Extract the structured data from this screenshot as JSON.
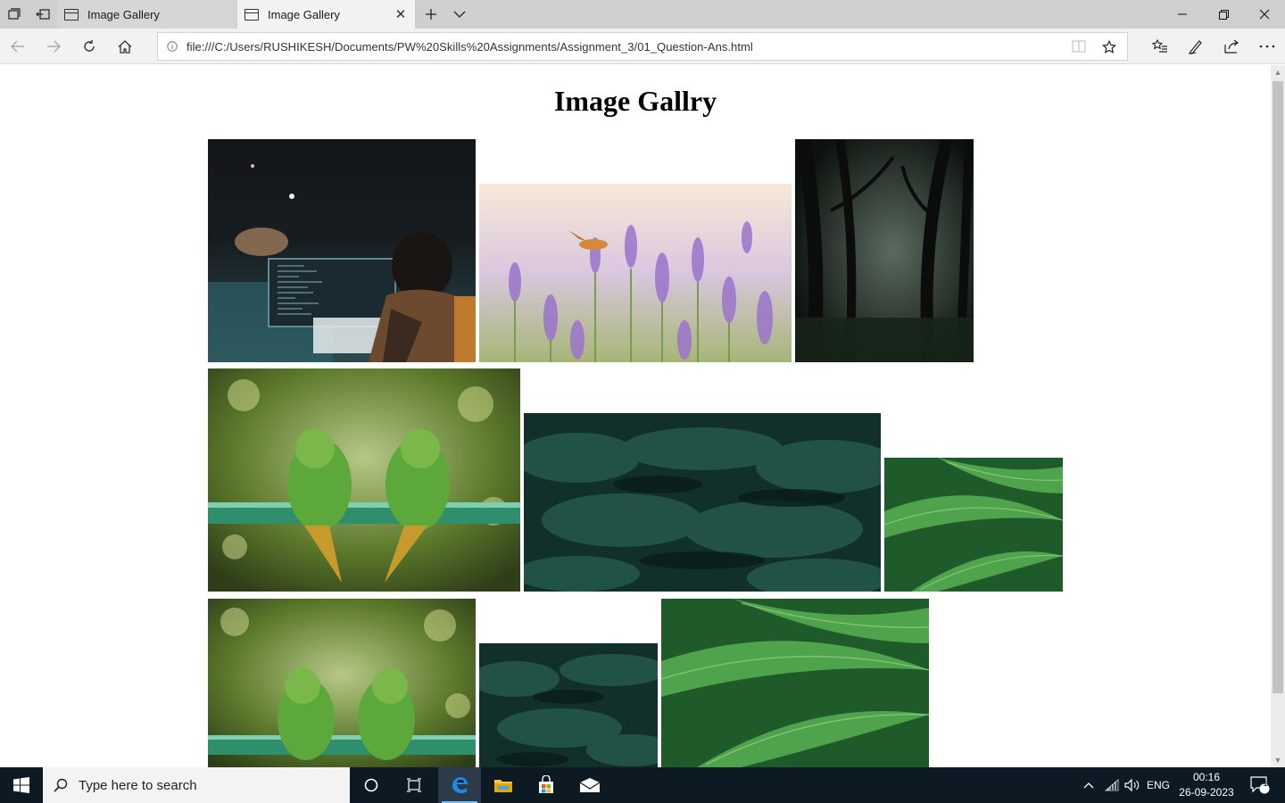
{
  "browser": {
    "tabs": [
      {
        "title": "Image Gallery",
        "active": false
      },
      {
        "title": "Image Gallery",
        "active": true
      }
    ],
    "address_url": "file:///C:/Users/RUSHIKESH/Documents/PW%20Skills%20Assignments/Assignment_3/01_Question-Ans.html",
    "tab_close_glyph": "✕"
  },
  "page": {
    "title": "Image Gallry"
  },
  "gallery": {
    "images": [
      {
        "name": "developer-at-desk-photo",
        "subject": "developer coding at desk",
        "palette": [
          "#141c20",
          "#1d3a40",
          "#3b6f74",
          "#8a5a34"
        ]
      },
      {
        "name": "lavender-moth-photo",
        "subject": "moth over lavender field",
        "palette": [
          "#f4e8d8",
          "#cdb8dc",
          "#9a78c8",
          "#9ab070"
        ]
      },
      {
        "name": "dark-forest-photo",
        "subject": "dark misty forest",
        "palette": [
          "#0e130f",
          "#2c3a2e",
          "#57665a",
          "#151c16"
        ]
      },
      {
        "name": "parrots-photo-1",
        "subject": "two green parrots on rail",
        "palette": [
          "#5b7b2c",
          "#9ab94a",
          "#2f8f5f",
          "#3a4a22"
        ]
      },
      {
        "name": "pine-foliage-photo-1",
        "subject": "dark pine foliage",
        "palette": [
          "#0f2a24",
          "#1f4a3c",
          "#2a5e4c",
          "#0b1d19"
        ]
      },
      {
        "name": "green-leaves-photo-1",
        "subject": "green ribbed leaves",
        "palette": [
          "#2f7a3a",
          "#5fb35a",
          "#1e5a2a",
          "#7cc46a"
        ]
      },
      {
        "name": "parrots-photo-2",
        "subject": "two green parrots on rail",
        "palette": [
          "#5b7b2c",
          "#9ab94a",
          "#2f8f5f",
          "#3a4a22"
        ]
      },
      {
        "name": "pine-foliage-photo-2",
        "subject": "dark pine foliage",
        "palette": [
          "#0f2a24",
          "#1f4a3c",
          "#2a5e4c",
          "#0b1d19"
        ]
      },
      {
        "name": "green-leaves-photo-2",
        "subject": "green ribbed leaves",
        "palette": [
          "#2f7a3a",
          "#5fb35a",
          "#1e5a2a",
          "#7cc46a"
        ]
      }
    ]
  },
  "taskbar": {
    "search_placeholder": "Type here to search",
    "language": "ENG",
    "time": "00:16",
    "date": "26-09-2023",
    "notification_count": "1"
  }
}
